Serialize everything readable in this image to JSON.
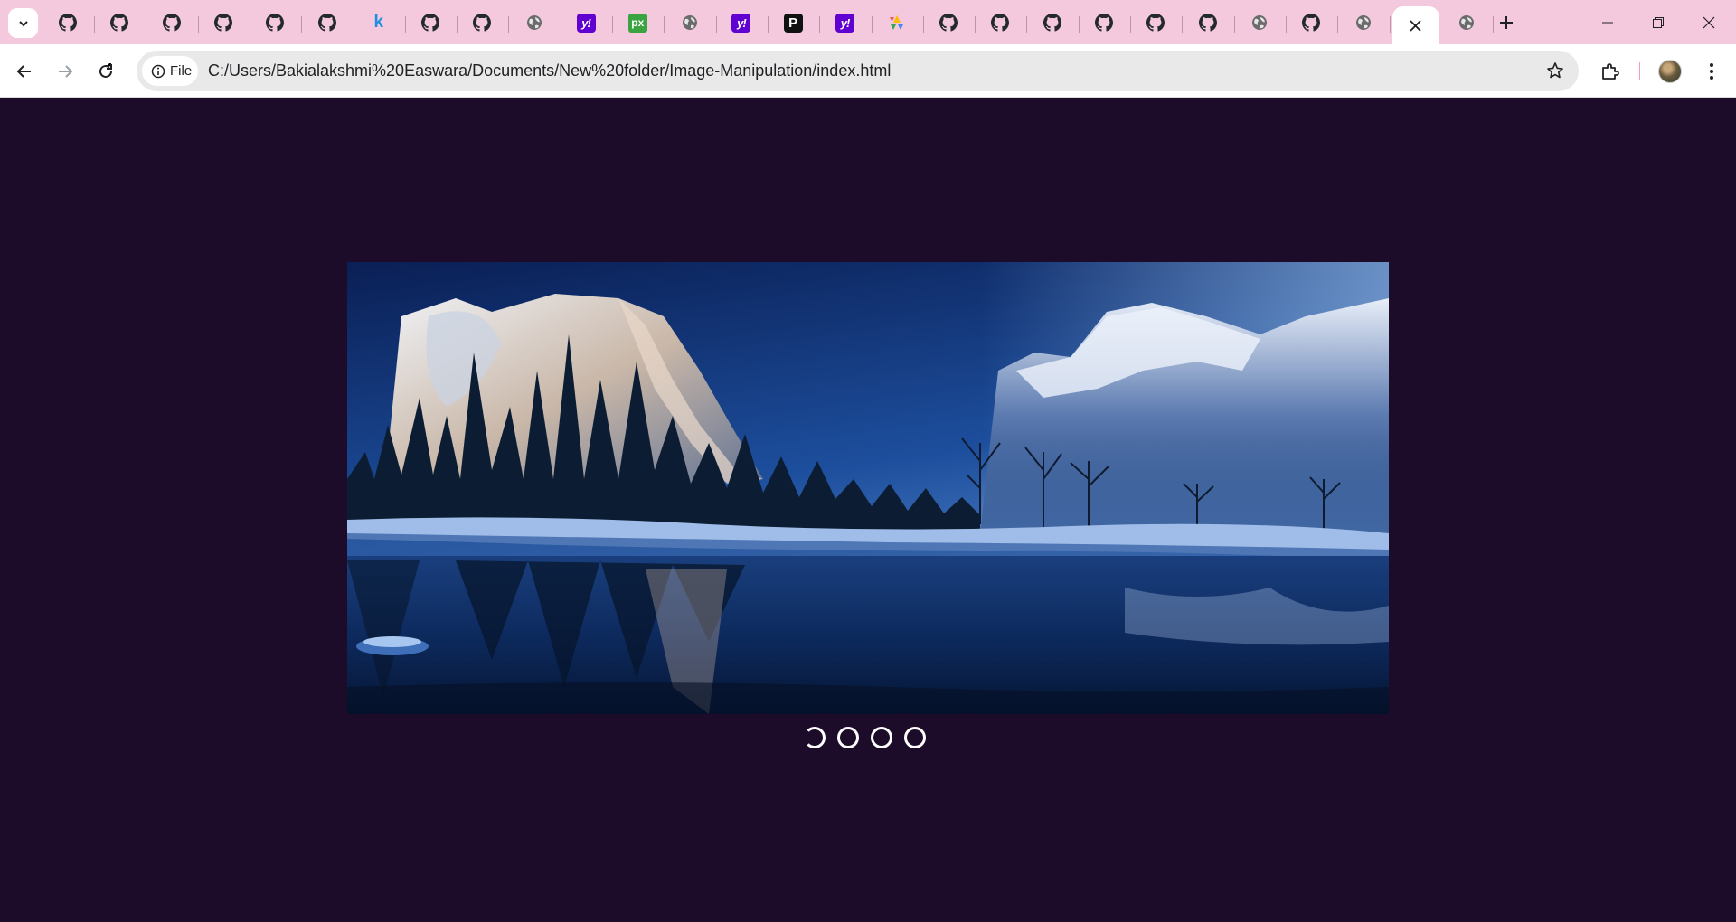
{
  "browser": {
    "tabs": [
      {
        "icon": "github-icon"
      },
      {
        "icon": "github-icon"
      },
      {
        "icon": "github-icon"
      },
      {
        "icon": "github-icon"
      },
      {
        "icon": "github-icon"
      },
      {
        "icon": "github-icon"
      },
      {
        "icon": "letter-k-icon",
        "letter": "k"
      },
      {
        "icon": "github-icon"
      },
      {
        "icon": "github-icon"
      },
      {
        "icon": "globe-icon"
      },
      {
        "icon": "yahoo-icon",
        "letter": "y!"
      },
      {
        "icon": "px-icon",
        "letter": "px"
      },
      {
        "icon": "globe-icon"
      },
      {
        "icon": "yahoo-icon",
        "letter": "y!"
      },
      {
        "icon": "p-icon",
        "letter": "P"
      },
      {
        "icon": "yahoo-icon",
        "letter": "y!"
      },
      {
        "icon": "colorful-icon"
      },
      {
        "icon": "github-icon"
      },
      {
        "icon": "github-icon"
      },
      {
        "icon": "github-icon"
      },
      {
        "icon": "github-icon"
      },
      {
        "icon": "github-icon"
      },
      {
        "icon": "github-icon"
      },
      {
        "icon": "globe-icon"
      },
      {
        "icon": "github-icon"
      },
      {
        "icon": "globe-icon"
      },
      {
        "icon": "close-icon",
        "active": true
      },
      {
        "icon": "globe-icon"
      }
    ],
    "address": {
      "chip_label": "File",
      "url": "C:/Users/Bakialakshmi%20Easwara/Documents/New%20folder/Image-Manipulation/index.html"
    }
  },
  "page": {
    "slider": {
      "image": "winter-lake-mountains",
      "dots": [
        {
          "active": true
        },
        {
          "active": false
        },
        {
          "active": false
        },
        {
          "active": false
        }
      ]
    }
  },
  "colors": {
    "tabstrip": "#f5c9dd",
    "page_background": "#1c0b29",
    "dot": "#ffffff"
  }
}
